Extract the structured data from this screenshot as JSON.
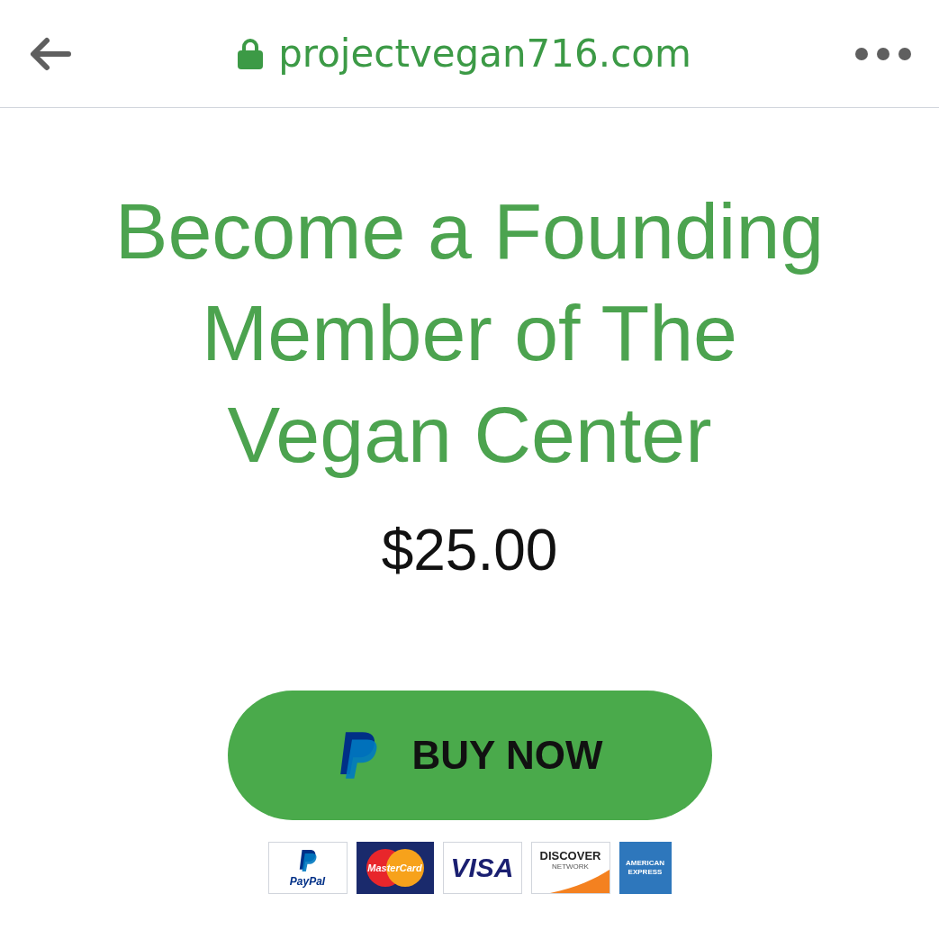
{
  "address_bar": {
    "url": "projectvegan716.com"
  },
  "heading": "Become a Founding Member of The Vegan Center",
  "price": "$25.00",
  "buy_button": {
    "label": "BUY NOW"
  },
  "payment_logos": [
    {
      "kind": "paypal",
      "texts": [
        "PayPal"
      ]
    },
    {
      "kind": "mastercard",
      "texts": [
        "MasterCard"
      ]
    },
    {
      "kind": "visa",
      "texts": [
        "VISA"
      ]
    },
    {
      "kind": "discover",
      "texts": [
        "DISCOVER",
        "NETWORK"
      ]
    },
    {
      "kind": "amex",
      "texts": [
        "AMERICAN",
        "EXPRESS"
      ]
    }
  ]
}
